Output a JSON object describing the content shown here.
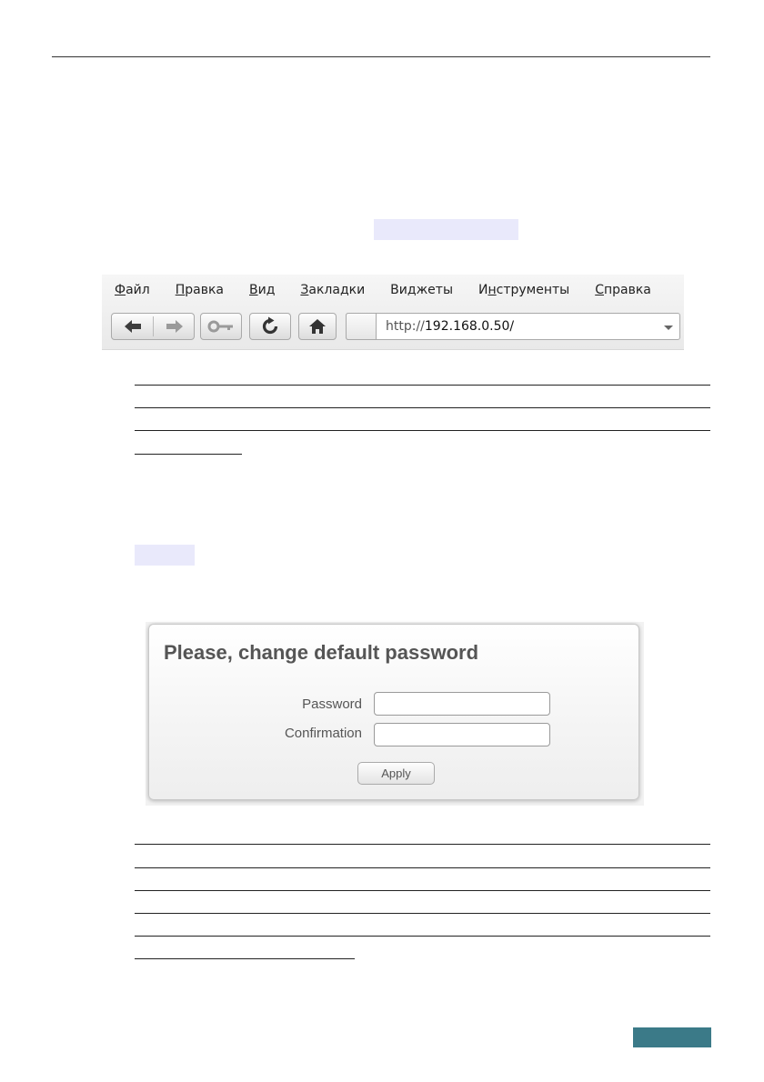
{
  "browser": {
    "menu": [
      {
        "accel": "Ф",
        "rest": "айл"
      },
      {
        "accel": "П",
        "rest": "равка"
      },
      {
        "accel": "В",
        "rest": "ид"
      },
      {
        "accel": "З",
        "rest": "акладки"
      },
      {
        "pre": "Ви",
        "accel": "д",
        "rest": "жеты"
      },
      {
        "pre": "И",
        "accel": "н",
        "rest": "струменты"
      },
      {
        "accel": "С",
        "rest": "правка"
      }
    ],
    "url_scheme": "http://",
    "url_host": "192.168.0.50/",
    "icons": {
      "back": "back-arrow-icon",
      "forward": "forward-arrow-icon",
      "key": "key-icon",
      "reload": "reload-icon",
      "home": "home-icon",
      "dropdown": "dropdown-arrow-icon"
    }
  },
  "dialog": {
    "title": "Please, change default password",
    "password_label": "Password",
    "confirmation_label": "Confirmation",
    "apply_label": "Apply"
  },
  "colors": {
    "highlight": "#e9e9fb",
    "page_badge": "#3b7a88"
  }
}
